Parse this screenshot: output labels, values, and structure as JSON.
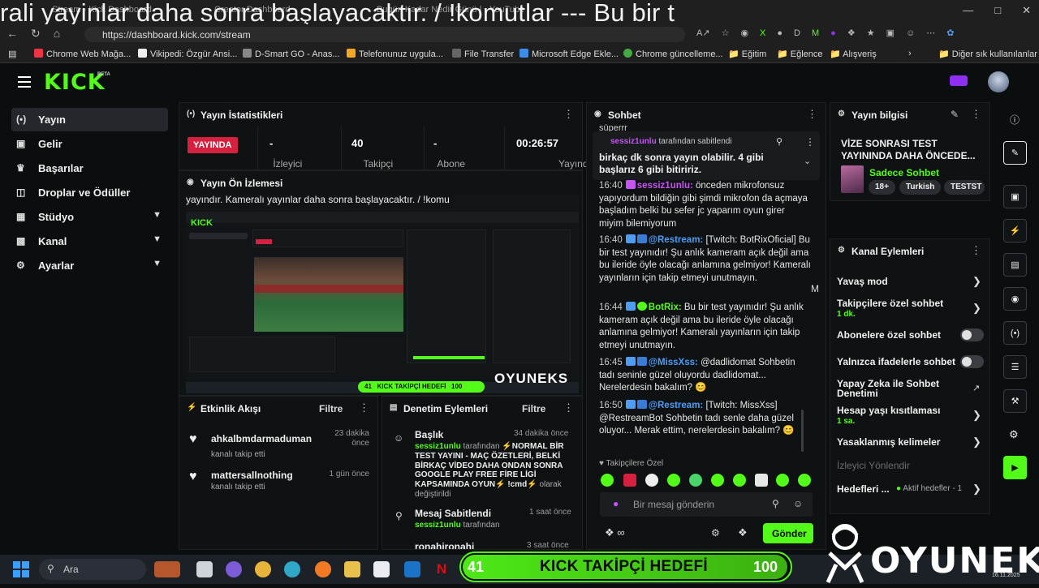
{
  "browser": {
    "tab_titles": [
      "Stream - Kick Dashboard",
      "Creator Dashboard",
      "Bugün Kadar Nedir Günü | - YouTube"
    ],
    "overlay_ticker": "rali yayinlar daha sonra başlayacaktır. / !komutlar --- Bu bir t",
    "url": "https://dashboard.kick.com/stream",
    "bookmarks": [
      "Chrome Web Mağa...",
      "Vikipedi: Özgür Ansi...",
      "D-Smart GO - Anas...",
      "Telefonunuz uygula...",
      "File Transfer",
      "Microsoft Edge Ekle...",
      "Chrome güncelleme...",
      "Eğitim",
      "Eğlence",
      "Alışveriş",
      "Diğer sık kullanılanlar"
    ]
  },
  "topbar": {
    "logo": "KICK",
    "beta": "BETA"
  },
  "sidebar": {
    "items": [
      {
        "label": "Yayın",
        "icon": "broadcast-icon"
      },
      {
        "label": "Gelir",
        "icon": "wallet-icon"
      },
      {
        "label": "Başarılar",
        "icon": "trophy-icon"
      },
      {
        "label": "Droplar ve Ödüller",
        "icon": "gift-icon"
      },
      {
        "label": "Stüdyo",
        "icon": "studio-icon"
      },
      {
        "label": "Kanal",
        "icon": "channel-icon"
      },
      {
        "label": "Ayarlar",
        "icon": "gear-icon"
      }
    ]
  },
  "stats": {
    "title": "Yayın İstatistikleri",
    "live": "YAYINDA",
    "items": [
      {
        "value": "-",
        "label": "İzleyici"
      },
      {
        "value": "40",
        "label": "Takipçi"
      },
      {
        "value": "-",
        "label": "Abone"
      },
      {
        "value": "00:26:57",
        "label": "Yayında"
      }
    ]
  },
  "preview": {
    "title": "Yayın Ön İzlemesi",
    "ticker": "yayındır. Kameralı yayınlar daha sonra başlayacaktır. / !komu",
    "brand": "OYUNEKS",
    "goal_left": "41",
    "goal_text": "KICK TAKİPÇİ HEDEFİ",
    "goal_right": "100"
  },
  "activity": {
    "title": "Etkinlik Akışı",
    "filter": "Filtre",
    "items": [
      {
        "user": "ahkalbmdarmaduman",
        "action": "kanalı takip etti",
        "time": "23 dakika önce"
      },
      {
        "user": "mattersallnothing",
        "action": "kanalı takip etti",
        "time": "1 gün önce"
      }
    ]
  },
  "moderation": {
    "title": "Denetim Eylemleri",
    "filter": "Filtre",
    "items": [
      {
        "heading": "Başlık",
        "time": "34 dakika önce",
        "user": "sessiz1unlu",
        "by": "tarafından",
        "body": "NORMAL BİR TEST YAYINI - MAÇ ÖZETLERİ, BELKİ BİRKAÇ VİDEO DAHA ONDAN SONRA GOOGLE PLAY FREE FİRE LİGİ KAPSAMINDA OYUN",
        "cmd": "!cmd",
        "tail": "olarak değiştirildi"
      },
      {
        "heading": "Mesaj Sabitlendi",
        "time": "1 saat önce",
        "user": "sessiz1unlu",
        "by": "tarafından"
      },
      {
        "heading": "ronahironahi",
        "time": "3 saat önce"
      }
    ]
  },
  "chat": {
    "title": "Sohbet",
    "scroll_top": "süperrr",
    "pinned_by": "sessiz1unlu",
    "pinned_by_suffix": "tarafından sabitlendi",
    "pinned_text": "birkaç dk sonra yayın olabilir. 4 gibi başlarız 6 gibi bitiririz.",
    "messages": [
      {
        "time": "16:40",
        "user": "sessiz1unlu:",
        "cls": "u-purple",
        "text": "önceden mikrofonsuz yapıyordum bildiğin gibi şimdi mikrofon da açmaya başladım belki bu sefer jc yaparım oyun girer miyim bilemiyorum"
      },
      {
        "time": "16:40",
        "user": "@Restream:",
        "cls": "u-blue",
        "text": "[Twitch: BotRixOficial] Bu bir test yayınıdır! Şu anlık kameram açık değil ama bu ileride öyle olacağı anlamına gelmiyor! Kameralı yayınların için takip etmeyi unutmayın."
      },
      {
        "time": "16:44",
        "user": "BotRix:",
        "cls": "u-green",
        "text": "Bu bir test yayınıdır! Şu anlık kameram açık değil ama bu ileride öyle olacağı anlamına gelmiyor! Kameralı yayınların için takip etmeyi unutmayın."
      },
      {
        "time": "16:45",
        "user": "@MissXss:",
        "cls": "u-blue",
        "text": "@dadlidomat Sohbetin tadı seninle güzel oluyordu dadlidomat... Nerelerdesin bakalım? 😊"
      },
      {
        "time": "16:50",
        "user": "@Restream:",
        "cls": "u-blue",
        "text": "[Twitch: MissXss] @RestreamBot Sohbetin tadı senle daha güzel oluyor... Merak ettim, nerelerdesin bakalım? 😊"
      }
    ],
    "followers_only": "Takipçilere Özel",
    "input_placeholder": "Bir mesaj gönderin",
    "send": "Gönder",
    "m_marker": "M"
  },
  "stream_info": {
    "title": "Yayın bilgisi",
    "stream_title": "VİZE SONRASI TEST YAYININDA DAHA ÖNCEDE...",
    "category": "Sadece Sohbet",
    "tags": [
      "18+",
      "Turkish",
      "TESTST"
    ]
  },
  "channel_actions": {
    "title": "Kanal Eylemleri",
    "items": [
      {
        "label": "Yavaş mod",
        "type": "arrow"
      },
      {
        "label": "Takipçilere özel sohbet",
        "sub": "1 dk.",
        "type": "arrow"
      },
      {
        "label": "Abonelere özel sohbet",
        "type": "toggle"
      },
      {
        "label": "Yalnızca ifadelerle sohbet",
        "type": "toggle"
      },
      {
        "label": "Yapay Zeka ile Sohbet Denetimi",
        "type": "external"
      },
      {
        "label": "Hesap yaşı kısıtlaması",
        "sub": "1 sa.",
        "type": "arrow"
      },
      {
        "label": "Yasaklanmış kelimeler",
        "type": "arrow"
      },
      {
        "label": "İzleyici Yönlendir",
        "type": "none"
      },
      {
        "label": "Hedefleri ...",
        "sub2": "Aktif hedefler - 1",
        "type": "arrow"
      }
    ]
  },
  "taskbar": {
    "search": "Ara",
    "date": "16.11.2025"
  },
  "colors": {
    "accent": "#53fc18",
    "live": "#d6203f",
    "purple": "#c455f0",
    "blue": "#4f9cf3"
  }
}
